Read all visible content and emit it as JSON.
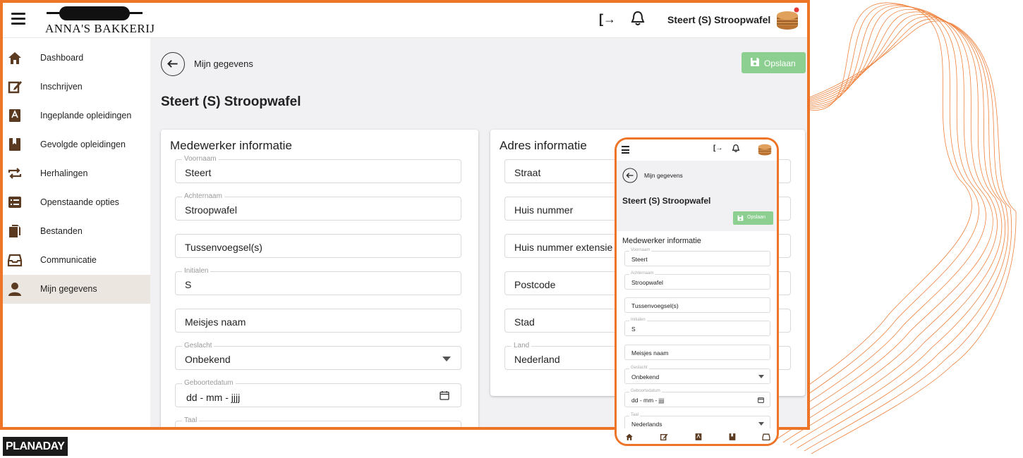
{
  "brand": {
    "logo_text": "ANNA'S BAKKERIJ",
    "accent": "#ee7427",
    "save_green": "#8ccf91",
    "footer_logo": "PLANADAY"
  },
  "header": {
    "user_name": "Steert (S) Stroopwafel",
    "icons": [
      "menu-icon",
      "logout-icon",
      "bell-icon",
      "avatar"
    ]
  },
  "sidebar": {
    "items": [
      {
        "label": "Dashboard",
        "icon": "home-icon",
        "active": false
      },
      {
        "label": "Inschrijven",
        "icon": "edit-icon",
        "active": false
      },
      {
        "label": "Ingeplande opleidingen",
        "icon": "book-icon",
        "active": false
      },
      {
        "label": "Gevolgde opleidingen",
        "icon": "bookmark-book-icon",
        "active": false
      },
      {
        "label": "Herhalingen",
        "icon": "repeat-icon",
        "active": false
      },
      {
        "label": "Openstaande opties",
        "icon": "list-icon",
        "active": false
      },
      {
        "label": "Bestanden",
        "icon": "files-icon",
        "active": false
      },
      {
        "label": "Communicatie",
        "icon": "inbox-icon",
        "active": false
      },
      {
        "label": "Mijn gegevens",
        "icon": "user-icon",
        "active": true
      }
    ]
  },
  "page": {
    "breadcrumb": "Mijn gegevens",
    "title": "Steert (S) Stroopwafel",
    "save_label": "Opslaan"
  },
  "employee": {
    "title": "Medewerker informatie",
    "fields": {
      "voornaam": {
        "label": "Voornaam",
        "value": "Steert"
      },
      "achternaam": {
        "label": "Achternaam",
        "value": "Stroopwafel"
      },
      "tussenvoegsel": {
        "placeholder": "Tussenvoegsel(s)"
      },
      "initialen": {
        "label": "Initialen",
        "value": "S"
      },
      "meisjesnaam": {
        "placeholder": "Meisjes naam"
      },
      "geslacht": {
        "label": "Geslacht",
        "value": "Onbekend"
      },
      "geboortedatum": {
        "label": "Geboortedatum",
        "value": "dd - mm - jjjj"
      },
      "taal": {
        "label": "Taal",
        "value": "Nederlands"
      }
    }
  },
  "address": {
    "title": "Adres informatie",
    "fields": {
      "straat": {
        "placeholder": "Straat"
      },
      "huisnummer": {
        "placeholder": "Huis nummer"
      },
      "extensie": {
        "placeholder": "Huis nummer extensie"
      },
      "postcode": {
        "placeholder": "Postcode"
      },
      "stad": {
        "placeholder": "Stad"
      },
      "land": {
        "label": "Land",
        "value": "Nederland"
      }
    }
  }
}
